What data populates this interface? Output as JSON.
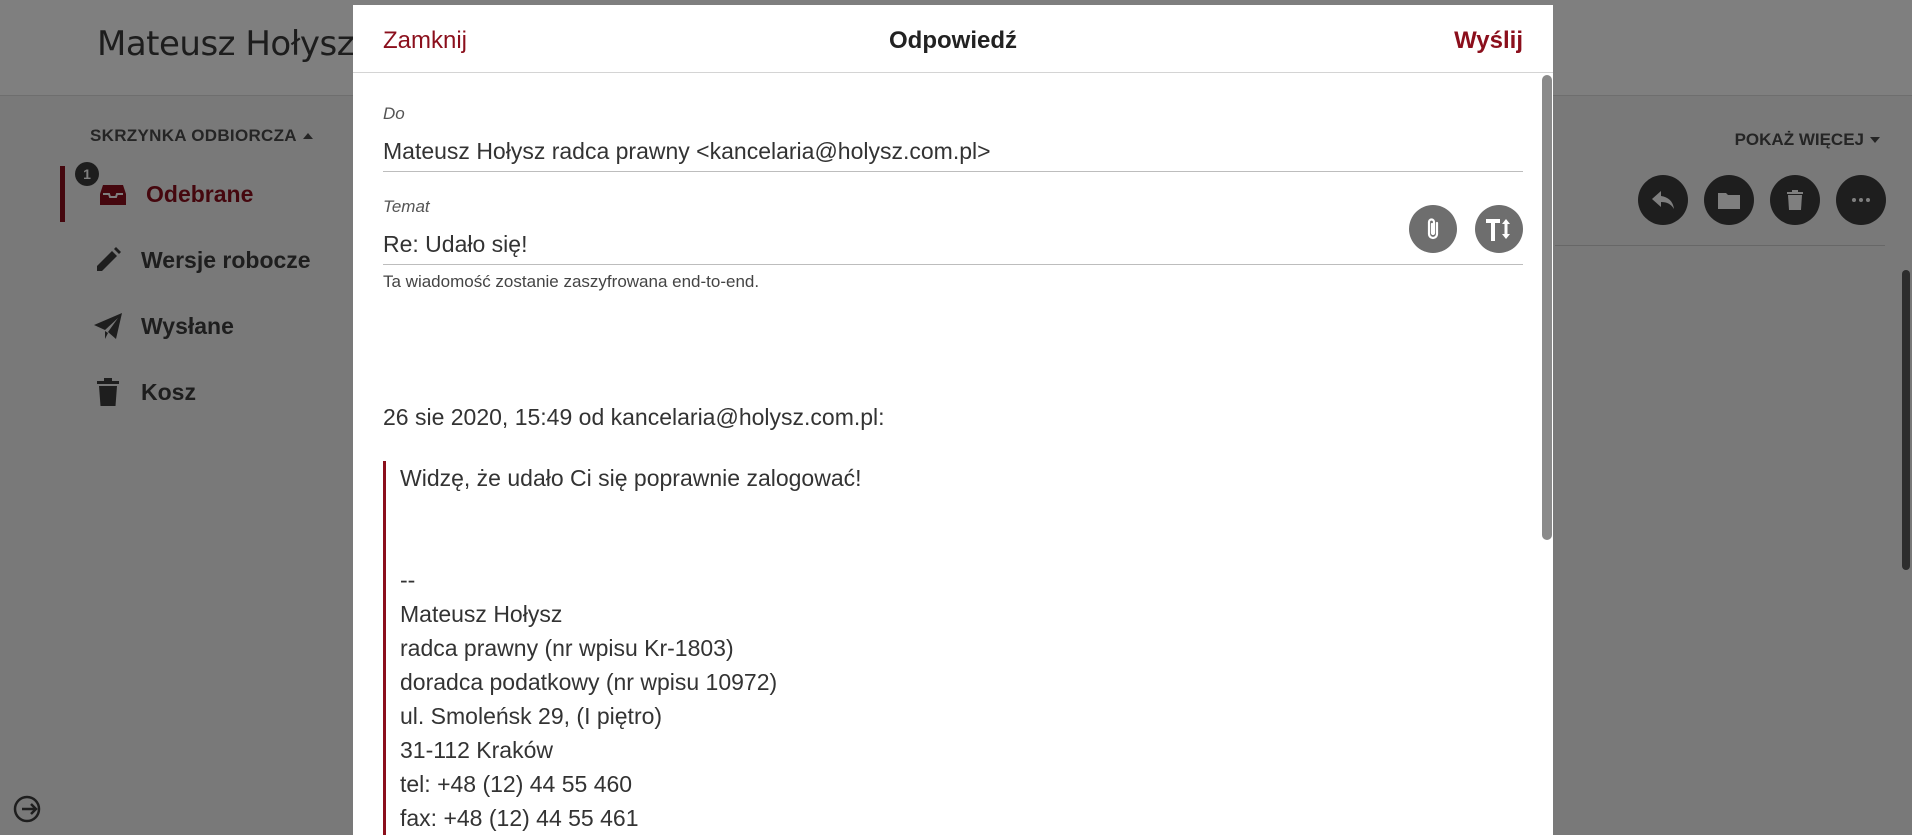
{
  "app": {
    "title": "Mateusz Hołysz radca prawny"
  },
  "sidebar": {
    "folder_heading": "SKRZYNKA ODBIORCZA",
    "items": [
      {
        "label": "Odebrane",
        "icon": "inbox-icon",
        "badge": "1",
        "active": true
      },
      {
        "label": "Wersje robocze",
        "icon": "pencil-icon"
      },
      {
        "label": "Wysłane",
        "icon": "paper-plane-icon"
      },
      {
        "label": "Kosz",
        "icon": "trash-icon"
      }
    ]
  },
  "toolbar": {
    "show_more_label": "POKAŻ WIĘCEJ",
    "actions": [
      "reply-icon",
      "folder-icon",
      "trash-icon",
      "more-icon"
    ]
  },
  "compose": {
    "close_label": "Zamknij",
    "title": "Odpowiedź",
    "send_label": "Wyślij",
    "to_label": "Do",
    "to_value": "Mateusz Hołysz radca prawny <kancelaria@holysz.com.pl>",
    "subject_label": "Temat",
    "subject_value": "Re: Udało się!",
    "encryption_hint": "Ta wiadomość zostanie zaszyfrowana end-to-end.",
    "quote_intro": "26 sie 2020, 15:49 od kancelaria@holysz.com.pl:",
    "quote_lines": [
      "Widzę, że udało Ci się poprawnie zalogować!",
      "",
      "",
      "--",
      "Mateusz Hołysz",
      "radca prawny (nr wpisu Kr-1803)",
      "doradca podatkowy (nr wpisu 10972)",
      "ul. Smoleńsk 29, (I piętro)",
      "31-112 Kraków",
      "tel: +48 (12) 44 55 460",
      "fax: +48 (12) 44 55 461"
    ]
  },
  "colors": {
    "accent": "#8b0f1c",
    "icon_button": "#6e6e6e"
  }
}
